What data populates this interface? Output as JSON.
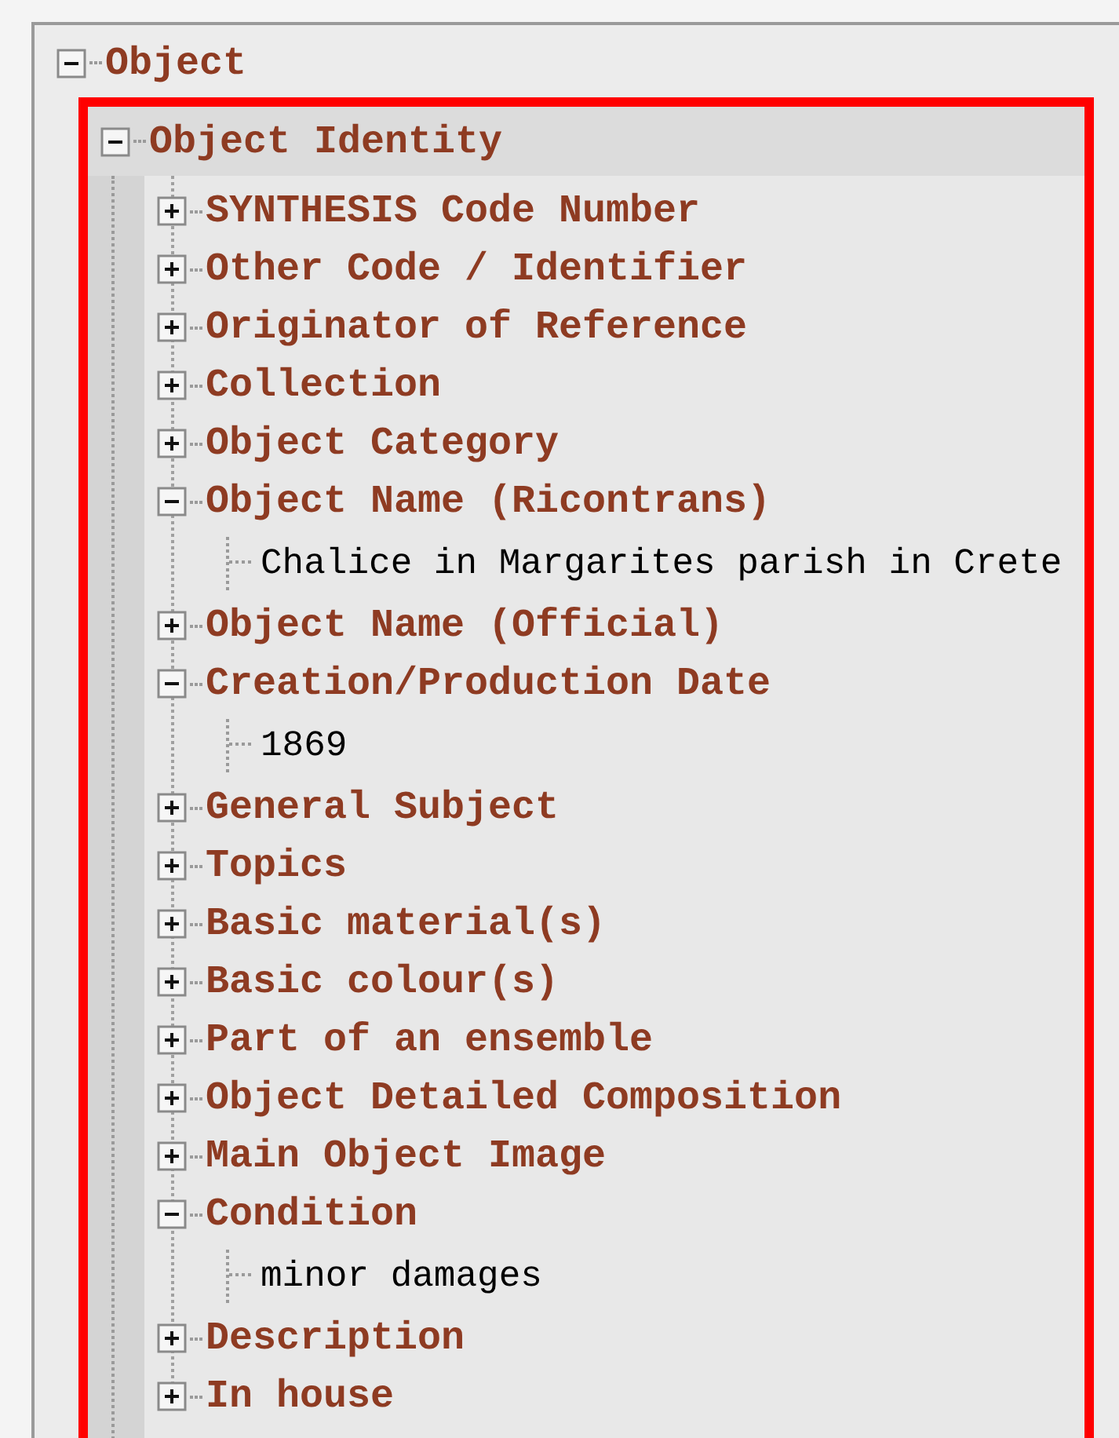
{
  "tree": [
    {
      "label": "Object",
      "expanded": true,
      "children": [
        {
          "label": "Object Identity",
          "expanded": true,
          "highlighted": true,
          "children": [
            {
              "label": "SYNTHESIS Code Number",
              "kind": "group",
              "expanded": false
            },
            {
              "label": "Other Code / Identifier",
              "kind": "group",
              "expanded": false
            },
            {
              "label": "Originator of Reference",
              "kind": "group",
              "expanded": false
            },
            {
              "label": "Collection",
              "kind": "group",
              "expanded": false
            },
            {
              "label": "Object Category",
              "kind": "group",
              "expanded": false
            },
            {
              "label": "Object Name (Ricontrans)",
              "kind": "group",
              "expanded": true,
              "children": [
                {
                  "label": "Chalice in Margarites parish in Crete",
                  "kind": "value"
                }
              ]
            },
            {
              "label": "Object Name (Official)",
              "kind": "group",
              "expanded": false
            },
            {
              "label": "Creation/Production Date",
              "kind": "group",
              "expanded": true,
              "children": [
                {
                  "label": "1869",
                  "kind": "value"
                }
              ]
            },
            {
              "label": "General Subject",
              "kind": "group",
              "expanded": false
            },
            {
              "label": "Topics",
              "kind": "group",
              "expanded": false
            },
            {
              "label": "Basic material(s)",
              "kind": "group",
              "expanded": false
            },
            {
              "label": "Basic colour(s)",
              "kind": "group",
              "expanded": false
            },
            {
              "label": "Part of an ensemble",
              "kind": "group",
              "expanded": false
            },
            {
              "label": "Object Detailed Composition",
              "kind": "group",
              "expanded": false
            },
            {
              "label": "Main Object Image",
              "kind": "group",
              "expanded": false
            },
            {
              "label": "Condition",
              "kind": "group",
              "expanded": true,
              "children": [
                {
                  "label": "minor damages",
                  "kind": "value"
                }
              ]
            },
            {
              "label": "Description",
              "kind": "group",
              "expanded": false
            },
            {
              "label": "In house",
              "kind": "group",
              "expanded": false
            }
          ]
        }
      ]
    }
  ]
}
